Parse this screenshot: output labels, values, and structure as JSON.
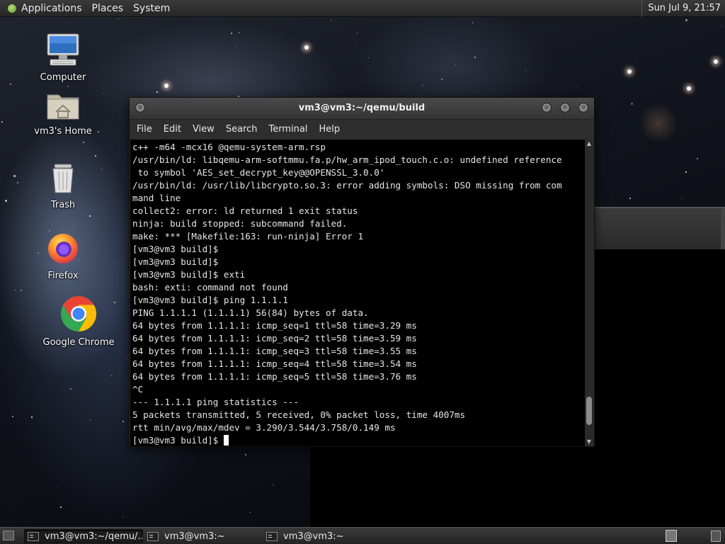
{
  "top_panel": {
    "menus": [
      "Applications",
      "Places",
      "System"
    ],
    "clock": "Sun Jul  9, 21:57"
  },
  "desktop": {
    "icons": [
      {
        "label": "Computer",
        "icon": "computer-icon"
      },
      {
        "label": "vm3's Home",
        "icon": "home-folder-icon"
      },
      {
        "label": "Trash",
        "icon": "trash-icon"
      },
      {
        "label": "Firefox",
        "icon": "firefox-icon"
      },
      {
        "label": "Google Chrome",
        "icon": "chrome-icon"
      }
    ]
  },
  "terminal": {
    "title": "vm3@vm3:~/qemu/build",
    "menu": [
      "File",
      "Edit",
      "View",
      "Search",
      "Terminal",
      "Help"
    ],
    "lines": [
      "c++ -m64 -mcx16 @qemu-system-arm.rsp",
      "/usr/bin/ld: libqemu-arm-softmmu.fa.p/hw_arm_ipod_touch.c.o: undefined reference",
      " to symbol 'AES_set_decrypt_key@@OPENSSL_3.0.0'",
      "/usr/bin/ld: /usr/lib/libcrypto.so.3: error adding symbols: DSO missing from com",
      "mand line",
      "collect2: error: ld returned 1 exit status",
      "ninja: build stopped: subcommand failed.",
      "make: *** [Makefile:163: run-ninja] Error 1",
      "[vm3@vm3 build]$",
      "[vm3@vm3 build]$",
      "[vm3@vm3 build]$ exti",
      "bash: exti: command not found",
      "[vm3@vm3 build]$ ping 1.1.1.1",
      "PING 1.1.1.1 (1.1.1.1) 56(84) bytes of data.",
      "64 bytes from 1.1.1.1: icmp_seq=1 ttl=58 time=3.29 ms",
      "64 bytes from 1.1.1.1: icmp_seq=2 ttl=58 time=3.59 ms",
      "64 bytes from 1.1.1.1: icmp_seq=3 ttl=58 time=3.55 ms",
      "64 bytes from 1.1.1.1: icmp_seq=4 ttl=58 time=3.54 ms",
      "64 bytes from 1.1.1.1: icmp_seq=5 ttl=58 time=3.76 ms",
      "^C",
      "--- 1.1.1.1 ping statistics ---",
      "5 packets transmitted, 5 received, 0% packet loss, time 4007ms",
      "rtt min/avg/max/mdev = 3.290/3.544/3.758/0.149 ms"
    ],
    "prompt": "[vm3@vm3 build]$ ",
    "scroll_position": 0.95
  },
  "taskbar": {
    "items": [
      {
        "label": "vm3@vm3:~/qemu/...",
        "active": true
      },
      {
        "label": "vm3@vm3:~",
        "active": false
      },
      {
        "label": "vm3@vm3:~",
        "active": false
      }
    ]
  }
}
